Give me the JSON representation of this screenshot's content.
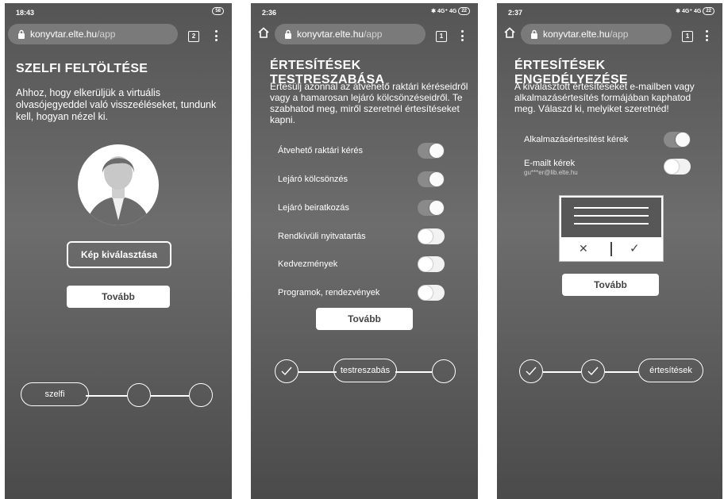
{
  "screens": [
    {
      "status": {
        "time": "18:43",
        "battery": "58"
      },
      "browser": {
        "url_host": "konyvtar.elte.hu",
        "url_path": "/app",
        "tab_count": "2"
      },
      "title": "SZELFI FELTÖLTÉSE",
      "description": "Ahhoz, hogy elkerüljük a virtuális olvasójegyeddel való visszeéléseket, tundunk kell, hogyan nézel ki.",
      "select_image_label": "Kép kiválasztása",
      "next_label": "Tovább",
      "stepper": {
        "current_label": "szelfi"
      }
    },
    {
      "status": {
        "time": "2:36",
        "signal": "4G⁺ 4G",
        "battery": "22"
      },
      "browser": {
        "url_host": "konyvtar.elte.hu",
        "url_path": "/app",
        "tab_count": "1"
      },
      "title": "ÉRTESÍTÉSEK TESTRESZABÁSA",
      "description": "Értesülj azonnal az átvehető raktári kéréseidről vagy a hamarosan lejáró kölcsönzéseidről. Te szabhatod meg, miről szeretnél értesítéseket kapni.",
      "toggles": [
        {
          "label": "Átvehető raktári kérés",
          "on": true
        },
        {
          "label": "Lejáró kölcsönzés",
          "on": true
        },
        {
          "label": "Lejáró beiratkozás",
          "on": true
        },
        {
          "label": "Rendkívüli nyitvatartás",
          "on": false
        },
        {
          "label": "Kedvezmények",
          "on": false
        },
        {
          "label": "Programok, rendezvények",
          "on": false
        }
      ],
      "next_label": "Tovább",
      "stepper": {
        "current_label": "testreszabás"
      }
    },
    {
      "status": {
        "time": "2:37",
        "signal": "4G⁺ 4G",
        "battery": "22"
      },
      "browser": {
        "url_host": "konyvtar.elte.hu",
        "url_path": "/app",
        "tab_count": "1"
      },
      "title": "ÉRTESÍTÉSEK ENGEDÉLYEZÉSE",
      "description": "A kiválasztott értesítéseket e-mailben vagy alkalmazásértesítés formájában kaphatod meg. Válaszd ki, melyiket szeretnéd!",
      "toggles": [
        {
          "label": "Alkalmazásértesítést kérek",
          "on": true
        },
        {
          "label": "E-mailt kérek",
          "sub": "gu***er@lib.elte.hu",
          "on": false
        }
      ],
      "dialog": {
        "deny_glyph": "✕",
        "accept_glyph": "✓"
      },
      "next_label": "Tovább",
      "stepper": {
        "current_label": "értesítések"
      }
    }
  ],
  "colors": {
    "background_top": "#555555",
    "background_bottom": "#4a4a4a",
    "toggle_on": "#8a8a8a",
    "toggle_off": "#f2f2f2",
    "button_text": "#444444"
  },
  "icons": [
    "home-icon",
    "lock-icon",
    "tabs-icon",
    "menu-icon",
    "bluetooth-icon",
    "check-icon",
    "avatar-icon"
  ]
}
